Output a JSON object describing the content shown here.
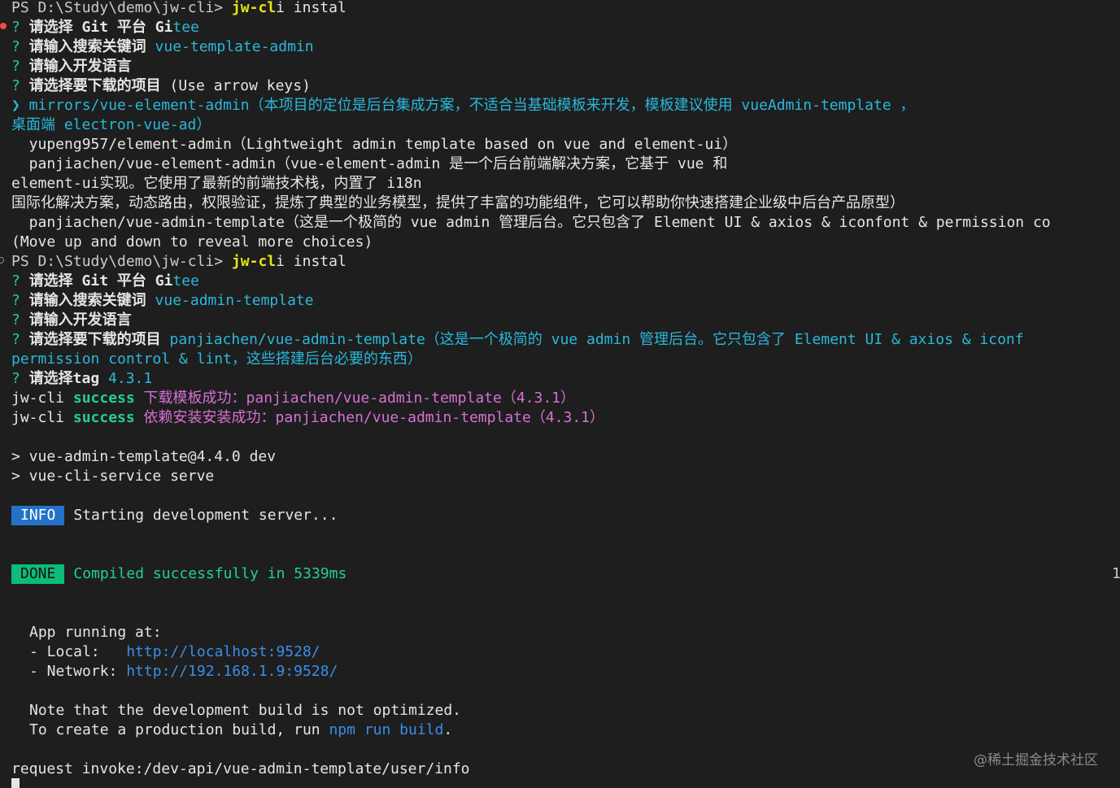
{
  "terminal": {
    "lines": [
      {
        "text": "PS D:\\Study\\demo\\jw-cli> jw-cli install"
      },
      {
        "text": "? 请选择 Git 平台 Gitee"
      },
      {
        "text": "? 请输入搜索关键词 vue-template-admin"
      },
      {
        "text": "? 请输入开发语言"
      },
      {
        "text": "? 请选择要下载的项目 (Use arrow keys)"
      },
      {
        "text": "❯ mirrors/vue-element-admin（本项目的定位是后台集成方案，不适合当基础模板来开发，模板建议使用 vueAdmin-template ，"
      },
      {
        "text": "桌面端 electron-vue-ad）"
      },
      {
        "text": "  yupeng957/element-admin（Lightweight admin template based on vue and element-ui）"
      },
      {
        "text": "  panjiachen/vue-element-admin（vue-element-admin 是一个后台前端解决方案，它基于 vue 和"
      },
      {
        "text": "element-ui实现。它使用了最新的前端技术栈，内置了 i18n"
      },
      {
        "text": "国际化解决方案，动态路由，权限验证，提炼了典型的业务模型，提供了丰富的功能组件，它可以帮助你快速搭建企业级中后台产品原型）"
      },
      {
        "text": "  panjiachen/vue-admin-template（这是一个极简的 vue admin 管理后台。它只包含了 Element UI & axios & iconfont & permission co"
      },
      {
        "text": "(Move up and down to reveal more choices)"
      },
      {
        "text": "PS D:\\Study\\demo\\jw-cli> jw-cli install"
      },
      {
        "text": "? 请选择 Git 平台 Gitee"
      },
      {
        "text": "? 请输入搜索关键词 vue-admin-template"
      },
      {
        "text": "? 请输入开发语言"
      },
      {
        "text": "? 请选择要下载的项目 panjiachen/vue-admin-template（这是一个极简的 vue admin 管理后台。它只包含了 Element UI & axios & iconf"
      },
      {
        "text": "permission control & lint，这些搭建后台必要的东西）"
      },
      {
        "text": "? 请选择tag 4.3.1"
      },
      {
        "text": "jw-cli success 下载模板成功：panjiachen/vue-admin-template（4.3.1）"
      },
      {
        "text": "jw-cli success 依赖安装安装成功：panjiachen/vue-admin-template（4.3.1）"
      },
      {
        "text": "> vue-admin-template@4.4.0 dev"
      },
      {
        "text": "> vue-cli-service serve"
      },
      {
        "text": "INFO Starting development server..."
      },
      {
        "text": "DONE Compiled successfully in 5339ms"
      },
      {
        "text": "App running at:"
      },
      {
        "text": "- Local:   http://localhost:9528/"
      },
      {
        "text": "- Network: http://192.168.1.9:9528/"
      },
      {
        "text": "Note that the development build is not optimized."
      },
      {
        "text": "To create a production build, run npm run build."
      },
      {
        "text": "request invoke:/dev-api/vue-admin-template/user/info"
      }
    ],
    "edge_number": "1",
    "watermark": "@稀土掘金技术社区"
  },
  "colors": {
    "background": "#1e1e1e",
    "foreground": "#cccccc",
    "prompt_green": "#23d18b",
    "answer_cyan": "#3b8eea",
    "command_yellow": "#e5e510",
    "success_magenta": "#d670d6",
    "info_badge": "#2472c8",
    "done_badge": "#0dbc79"
  }
}
